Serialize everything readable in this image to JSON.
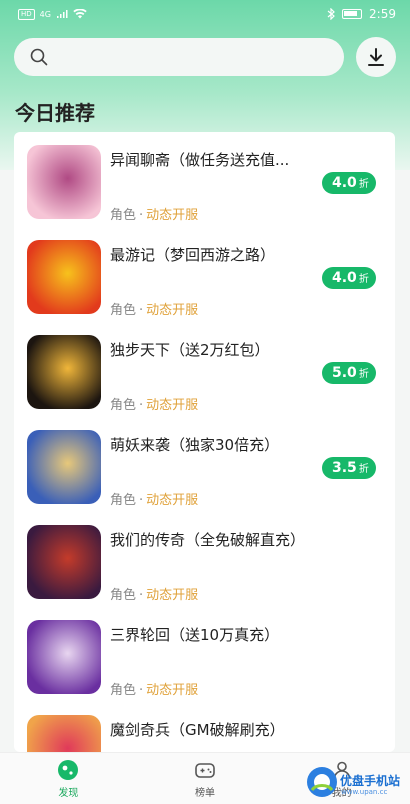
{
  "status_bar": {
    "left_badges": [
      "HD",
      "4G"
    ],
    "time": "2:59"
  },
  "search": {
    "placeholder": ""
  },
  "section": {
    "title": "今日推荐"
  },
  "games": [
    {
      "name": "异闻聊斋（做任务送充值...",
      "category": "角色",
      "separator": "·",
      "status": "动态开服",
      "discount": "4.0",
      "discount_unit": "折",
      "thumb_colors": [
        "#f6c5d6",
        "#b04a84"
      ]
    },
    {
      "name": "最游记（梦回西游之路）",
      "category": "角色",
      "separator": "·",
      "status": "动态开服",
      "discount": "4.0",
      "discount_unit": "折",
      "thumb_colors": [
        "#e23a1c",
        "#f7c21c"
      ]
    },
    {
      "name": "独步天下（送2万红包）",
      "category": "角色",
      "separator": "·",
      "status": "动态开服",
      "discount": "5.0",
      "discount_unit": "折",
      "thumb_colors": [
        "#1c1510",
        "#f0b63a"
      ]
    },
    {
      "name": "萌妖来袭（独家30倍充）",
      "category": "角色",
      "separator": "·",
      "status": "动态开服",
      "discount": "3.5",
      "discount_unit": "折",
      "thumb_colors": [
        "#3a5fb8",
        "#e7c87a"
      ]
    },
    {
      "name": "我们的传奇（全免破解直充）",
      "category": "角色",
      "separator": "·",
      "status": "动态开服",
      "discount": "",
      "discount_unit": "",
      "thumb_colors": [
        "#3a1a3f",
        "#c43b2a"
      ]
    },
    {
      "name": "三界轮回（送10万真充）",
      "category": "角色",
      "separator": "·",
      "status": "动态开服",
      "discount": "",
      "discount_unit": "",
      "thumb_colors": [
        "#6a2fa0",
        "#e8d6f0"
      ]
    },
    {
      "name": "魔剑奇兵（GM破解刷充）",
      "category": "",
      "separator": "",
      "status": "",
      "discount": "",
      "discount_unit": "",
      "thumb_colors": [
        "#f0a44a",
        "#e03a5a"
      ]
    }
  ],
  "tabs": [
    {
      "label": "发现",
      "icon": "discover-icon",
      "active": true
    },
    {
      "label": "榜单",
      "icon": "gamepad-icon",
      "active": false
    },
    {
      "label": "我的",
      "icon": "user-icon",
      "active": false
    }
  ],
  "watermark": {
    "text": "优盘手机站",
    "url": "www.upan.cc"
  },
  "colors": {
    "accent": "#17b869",
    "status_open": "#e0a23a",
    "header_top": "#6cd8a9"
  }
}
